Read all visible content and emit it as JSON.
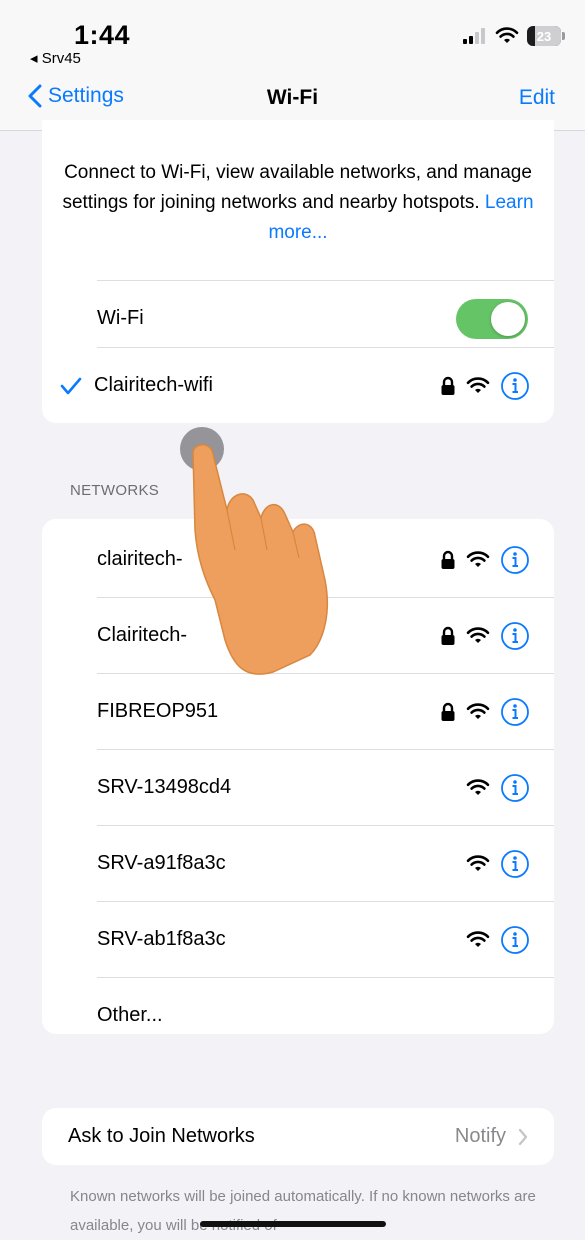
{
  "status_bar": {
    "time": "1:44",
    "back_app": "◂ Srv45",
    "battery": "23",
    "battery_level": 0.23
  },
  "nav": {
    "back_label": "Settings",
    "title": "Wi-Fi",
    "edit_label": "Edit"
  },
  "intro": {
    "text": "Connect to Wi-Fi, view available networks, and manage settings for joining networks and nearby hotspots.",
    "link": "Learn more..."
  },
  "wifi": {
    "label": "Wi-Fi",
    "enabled": true,
    "connected_network": "Clairitech-wifi"
  },
  "networks_header": "NETWORKS",
  "networks": [
    {
      "name": "clairitech-",
      "locked": true
    },
    {
      "name": "Clairitech-",
      "locked": true
    },
    {
      "name": "FIBREOP951",
      "locked": true
    },
    {
      "name": "SRV-13498cd4",
      "locked": false
    },
    {
      "name": "SRV-a91f8a3c",
      "locked": false
    },
    {
      "name": "SRV-ab1f8a3c",
      "locked": false
    }
  ],
  "other_label": "Other...",
  "ask_to_join": {
    "label": "Ask to Join Networks",
    "value": "Notify"
  },
  "footer": "Known networks will be joined automatically. If no known networks are available, you will be notified of",
  "colors": {
    "accent": "#0a7aff",
    "toggle_on": "#65c466"
  }
}
